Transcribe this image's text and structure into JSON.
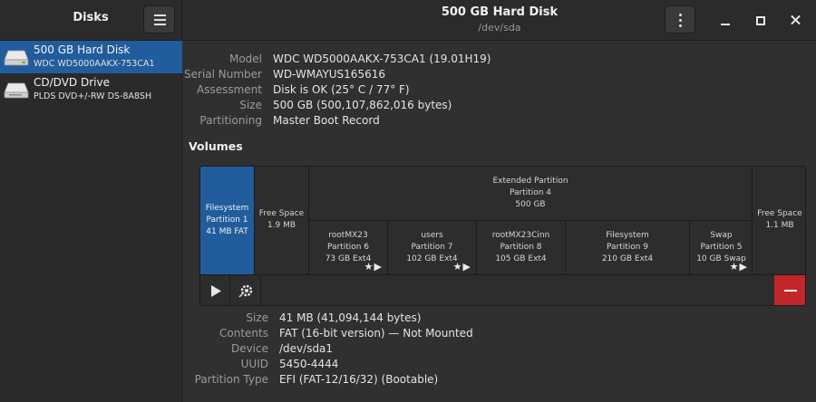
{
  "sidebar": {
    "title": "Disks",
    "disks": [
      {
        "name": "500 GB Hard Disk",
        "model": "WDC WD5000AAKX-753CA1"
      },
      {
        "name": "CD/DVD Drive",
        "model": "PLDS DVD+/-RW DS-8A8SH"
      }
    ]
  },
  "header": {
    "title": "500 GB Hard Disk",
    "subtitle": "/dev/sda"
  },
  "disk_info": [
    {
      "key": "Model",
      "value": "WDC WD5000AAKX-753CA1 (19.01H19)"
    },
    {
      "key": "Serial Number",
      "value": "WD-WMAYUS165616"
    },
    {
      "key": "Assessment",
      "value": "Disk is OK (25° C / 77° F)"
    },
    {
      "key": "Size",
      "value": "500 GB (500,107,862,016 bytes)"
    },
    {
      "key": "Partitioning",
      "value": "Master Boot Record"
    }
  ],
  "volumes": {
    "title": "Volumes",
    "p1": {
      "l1": "Filesystem",
      "l2": "Partition 1",
      "l3": "41 MB FAT"
    },
    "free1": {
      "l1": "Free Space",
      "l2": "1.9 MB"
    },
    "extended": {
      "l1": "Extended Partition",
      "l2": "Partition 4",
      "l3": "500 GB"
    },
    "p6": {
      "l1": "rootMX23",
      "l2": "Partition 6",
      "l3": "73 GB Ext4"
    },
    "p7": {
      "l1": "users",
      "l2": "Partition 7",
      "l3": "102 GB Ext4"
    },
    "p8": {
      "l1": "rootMX23Cinn",
      "l2": "Partition 8",
      "l3": "105 GB Ext4"
    },
    "p9": {
      "l1": "Filesystem",
      "l2": "Partition 9",
      "l3": "210 GB Ext4"
    },
    "p5": {
      "l1": "Swap",
      "l2": "Partition 5",
      "l3": "10 GB Swap"
    },
    "free2": {
      "l1": "Free Space",
      "l2": "1.1 MB"
    }
  },
  "partition_info": [
    {
      "key": "Size",
      "value": "41 MB (41,094,144 bytes)"
    },
    {
      "key": "Contents",
      "value": "FAT (16-bit version) — Not Mounted"
    },
    {
      "key": "Device",
      "value": "/dev/sda1"
    },
    {
      "key": "UUID",
      "value": "5450-4444"
    },
    {
      "key": "Partition Type",
      "value": "EFI (FAT-12/16/32) (Bootable)"
    }
  ],
  "colors": {
    "accent": "#215d9c",
    "danger": "#c0262a",
    "bg": "#303030"
  },
  "icons": [
    "menu-icon",
    "kebab-menu-icon",
    "minimize-icon",
    "maximize-icon",
    "close-icon",
    "hard-disk-icon",
    "optical-drive-icon",
    "play-icon",
    "gear-icon",
    "minus-icon",
    "star-icon"
  ]
}
